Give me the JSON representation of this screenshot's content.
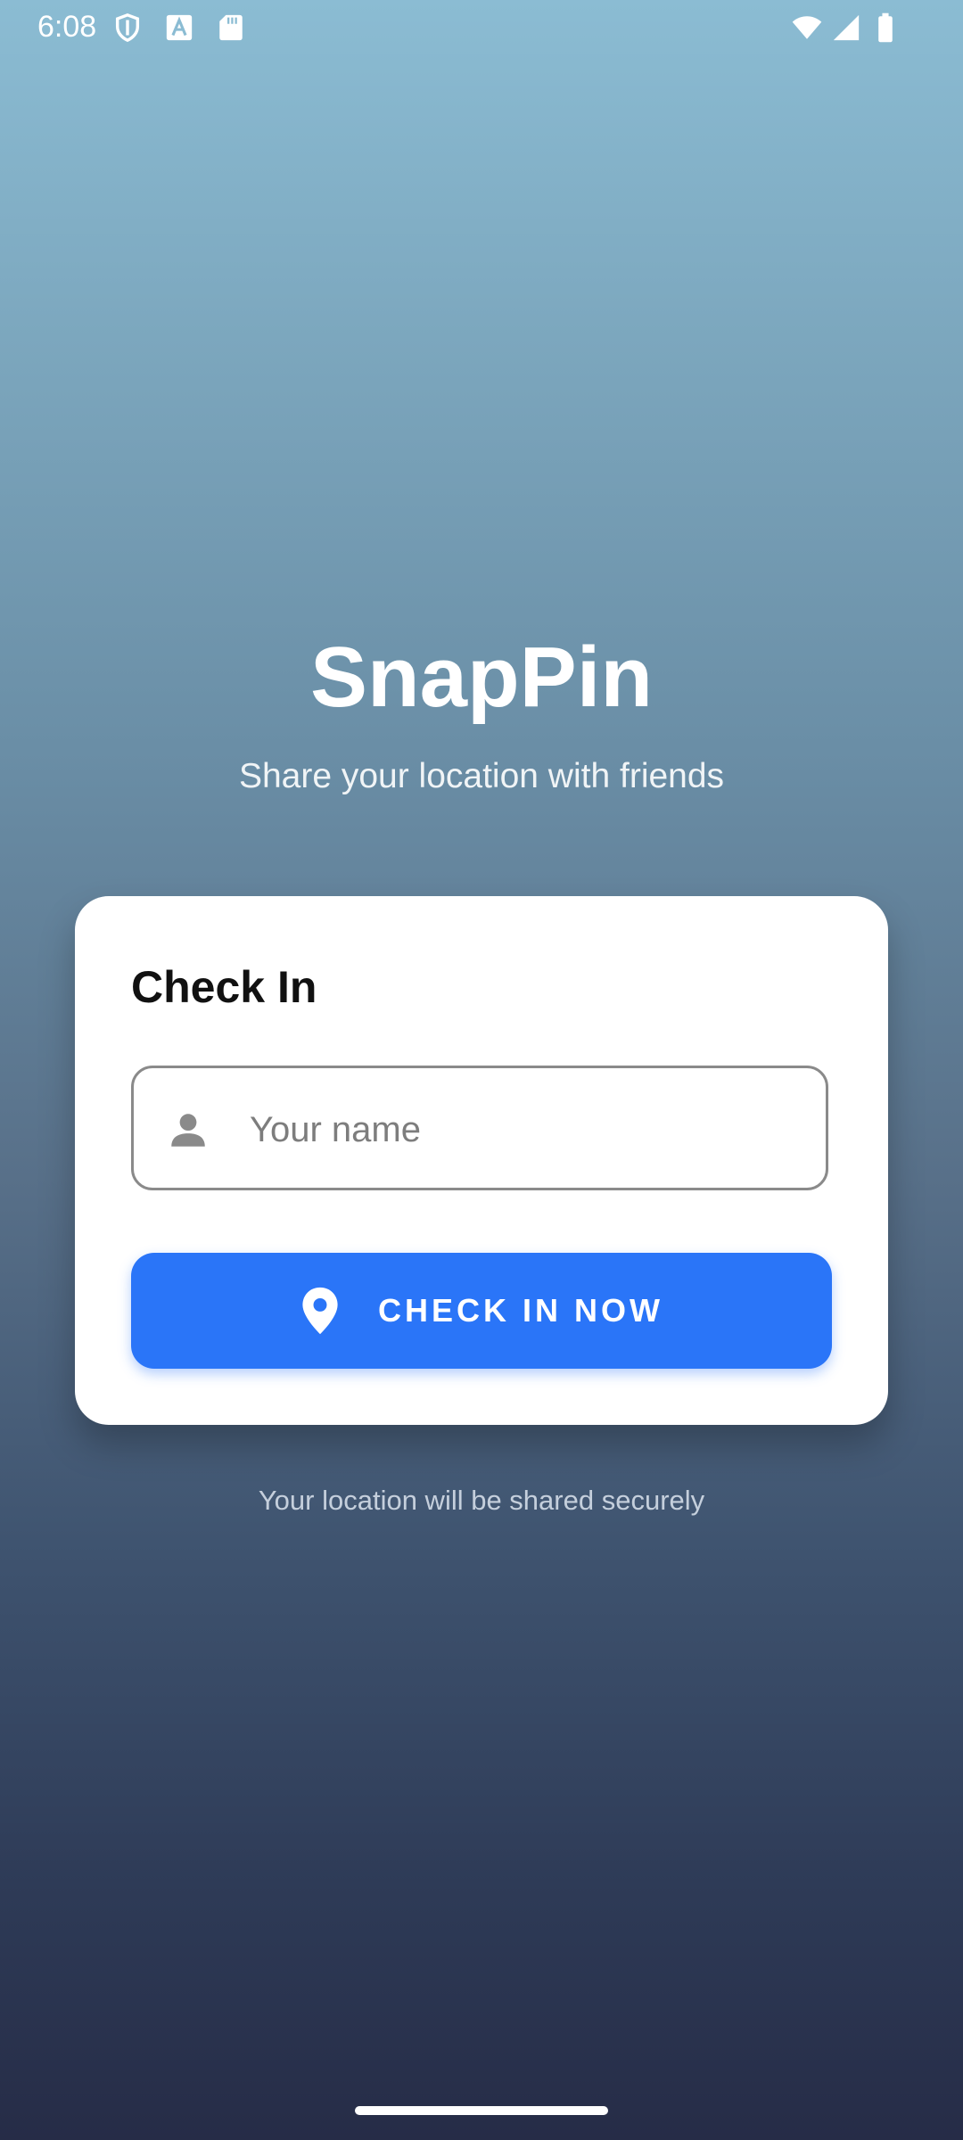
{
  "status_bar": {
    "time": "6:08",
    "icons": [
      "shield-icon",
      "font-icon",
      "sd-card-icon",
      "wifi-icon",
      "cell-signal-icon",
      "battery-icon"
    ]
  },
  "header": {
    "title": "SnapPin",
    "subtitle": "Share your location with friends"
  },
  "card": {
    "title": "Check In",
    "name_field": {
      "placeholder": "Your name",
      "value": "",
      "icon": "person-icon"
    },
    "checkin_button": {
      "label": "CHECK IN NOW",
      "icon": "location-pin-icon"
    }
  },
  "footer": {
    "note": "Your location will be shared securely"
  },
  "colors": {
    "accent": "#2a75f8",
    "card_background": "#ffffff",
    "gradient_top": "#8bbcd3",
    "gradient_bottom": "#262c47"
  }
}
